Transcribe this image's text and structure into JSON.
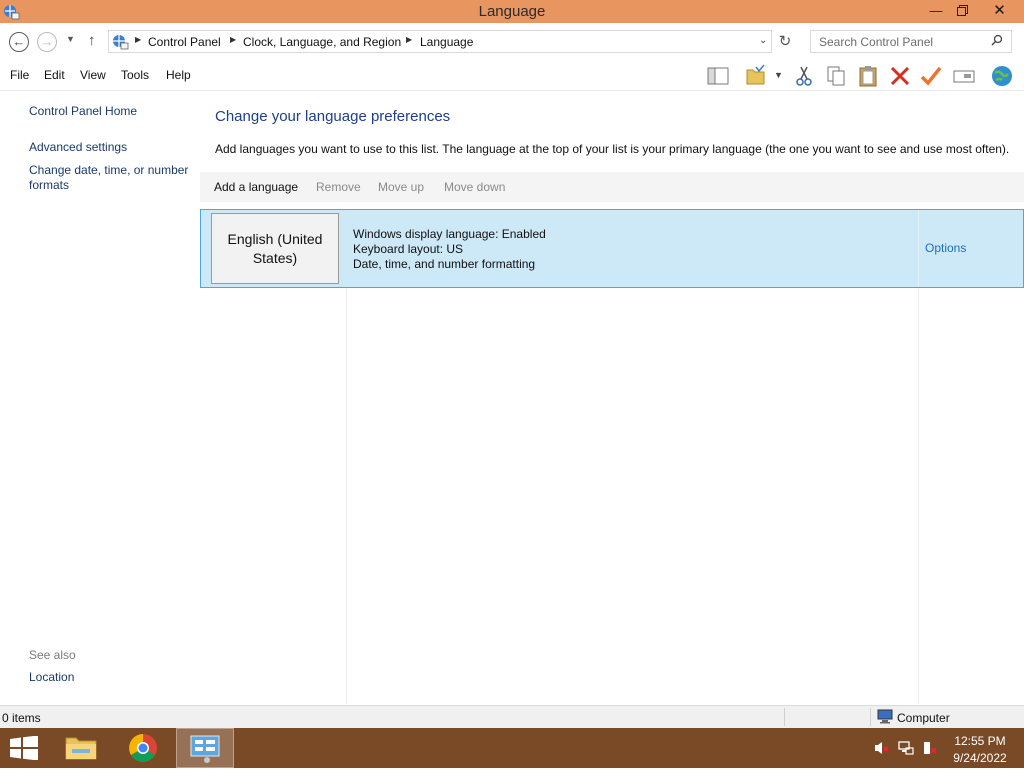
{
  "window": {
    "title": "Language"
  },
  "address": {
    "crumbs": [
      "Control Panel",
      "Clock, Language, and Region",
      "Language"
    ],
    "search_placeholder": "Search Control Panel"
  },
  "menu": [
    "File",
    "Edit",
    "View",
    "Tools",
    "Help"
  ],
  "sidebar": {
    "home": "Control Panel Home",
    "advanced": "Advanced settings",
    "change_line1": "Change date, time, or number",
    "change_line2": "formats",
    "see_also": "See also",
    "location": "Location"
  },
  "main": {
    "title": "Change your language preferences",
    "description": "Add languages you want to use to this list. The language at the top of your list is your primary language (the one you want to see and use most often).",
    "commands": {
      "add": "Add a language",
      "remove": "Remove",
      "move_up": "Move up",
      "move_down": "Move down"
    },
    "languages": [
      {
        "name": "English (United States)",
        "details": [
          "Windows display language: Enabled",
          "Keyboard layout: US",
          "Date, time, and number formatting"
        ],
        "options": "Options"
      }
    ]
  },
  "status": {
    "items": "0 items",
    "location": "Computer"
  },
  "taskbar": {
    "time": "12:55 PM",
    "date": "9/24/2022"
  },
  "colors": {
    "titlebar": "#e9955f",
    "taskbar": "#7a4a26",
    "selection": "#cde8f7",
    "link": "#1f6fbf",
    "heading": "#1e3f8a"
  }
}
